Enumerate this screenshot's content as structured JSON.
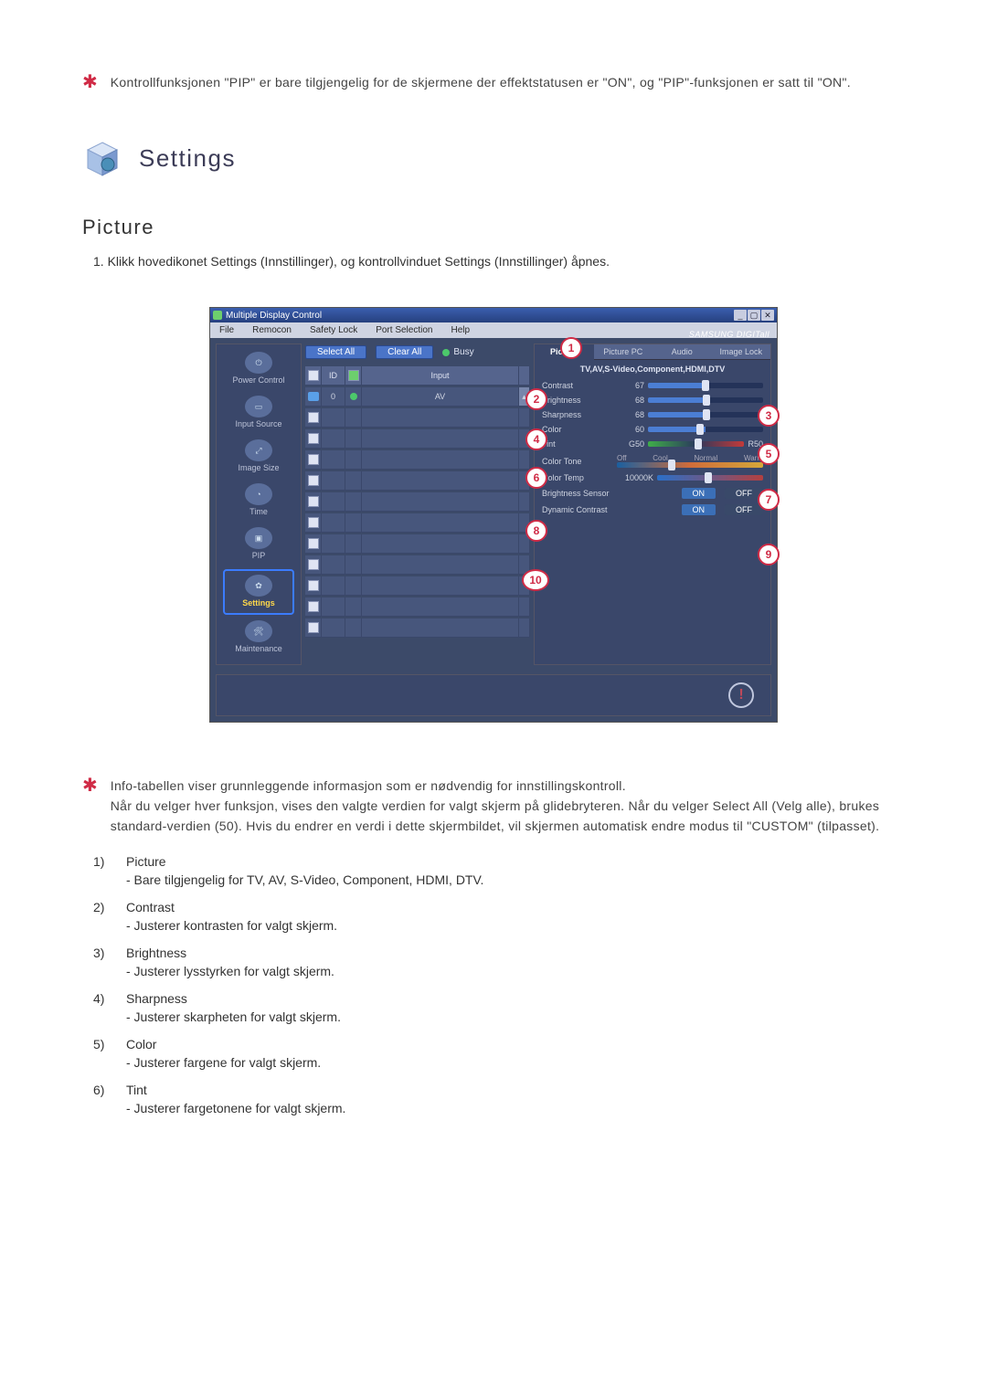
{
  "top_note": "Kontrollfunksjonen \"PIP\" er bare tilgjengelig for de skjermene der effektstatusen er \"ON\", og \"PIP\"-funksjonen er satt til \"ON\".",
  "section_title": "Settings",
  "subsection_title": "Picture",
  "instruction_num": "1.",
  "instruction_text": "Klikk hovedikonet Settings (Innstillinger), og kontrollvinduet Settings (Innstillinger) åpnes.",
  "app": {
    "title": "Multiple Display Control",
    "brand": "SAMSUNG DIGITall",
    "menu": [
      "File",
      "Remocon",
      "Safety Lock",
      "Port Selection",
      "Help"
    ],
    "sidebar": [
      {
        "label": "Power Control"
      },
      {
        "label": "Input Source"
      },
      {
        "label": "Image Size"
      },
      {
        "label": "Time"
      },
      {
        "label": "PIP"
      },
      {
        "label": "Settings",
        "selected": true
      },
      {
        "label": "Maintenance"
      }
    ],
    "toolbar": {
      "select_all": "Select All",
      "clear_all": "Clear All",
      "busy": "Busy"
    },
    "grid": {
      "headers": {
        "id": "ID",
        "input": "Input"
      },
      "first_row": {
        "id": "0",
        "input": "AV"
      }
    },
    "panel": {
      "tabs": [
        "Picture",
        "Picture PC",
        "Audio",
        "Image Lock"
      ],
      "mode": "TV,AV,S-Video,Component,HDMI,DTV",
      "contrast": {
        "label": "Contrast",
        "value": "67"
      },
      "brightness": {
        "label": "Brightness",
        "value": "68"
      },
      "sharpness": {
        "label": "Sharpness",
        "value": "68"
      },
      "color": {
        "label": "Color",
        "value": "60"
      },
      "tint": {
        "label": "Tint",
        "g": "G50",
        "r": "R50"
      },
      "colortone": {
        "label": "Color Tone",
        "opts": [
          "Off",
          "Cool",
          "Normal",
          "Warm"
        ]
      },
      "colortemp": {
        "label": "Color Temp",
        "value": "10000K"
      },
      "brightness_sensor": {
        "label": "Brightness Sensor",
        "on": "ON",
        "off": "OFF"
      },
      "dynamic_contrast": {
        "label": "Dynamic Contrast",
        "on": "ON",
        "off": "OFF"
      }
    }
  },
  "mid_note": "Info-tabellen viser grunnleggende informasjon som er nødvendig for innstillingskontroll.\nNår du velger hver funksjon, vises den valgte verdien for valgt skjerm på glidebryteren. Når du velger Select All (Velg alle), brukes standard-verdien (50). Hvis du endrer en verdi i dette skjermbildet, vil skjermen automatisk endre modus til \"CUSTOM\" (tilpasset).",
  "list": [
    {
      "num": "1)",
      "title": "Picture",
      "desc": "- Bare tilgjengelig for TV, AV, S-Video, Component, HDMI, DTV."
    },
    {
      "num": "2)",
      "title": "Contrast",
      "desc": "- Justerer kontrasten for valgt skjerm."
    },
    {
      "num": "3)",
      "title": "Brightness",
      "desc": "- Justerer lysstyrken for valgt skjerm."
    },
    {
      "num": "4)",
      "title": "Sharpness",
      "desc": "- Justerer skarpheten for valgt skjerm."
    },
    {
      "num": "5)",
      "title": "Color",
      "desc": "- Justerer fargene for valgt skjerm."
    },
    {
      "num": "6)",
      "title": "Tint",
      "desc": "- Justerer fargetonene for valgt skjerm."
    }
  ],
  "callouts": [
    "1",
    "2",
    "3",
    "4",
    "5",
    "6",
    "7",
    "8",
    "9",
    "10"
  ]
}
